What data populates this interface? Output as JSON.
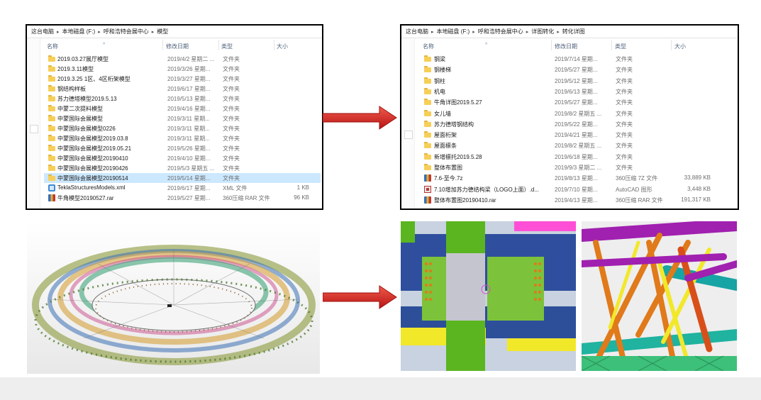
{
  "colors": {
    "arrow": "#d61f1f",
    "selection": "#cce8ff",
    "folder": "#f7cf58"
  },
  "left_explorer": {
    "breadcrumb": [
      "这台电脑",
      "本地磁盘 (F:)",
      "呼和浩特会展中心",
      "模型"
    ],
    "columns": {
      "name": "名称",
      "date": "修改日期",
      "type": "类型",
      "size": "大小"
    },
    "files": [
      {
        "name": "2019.03.27展厅模型",
        "date": "2019/4/2 星期二 ...",
        "type": "文件夹",
        "size": "",
        "icon": "folder-icon"
      },
      {
        "name": "2019.3.11模型",
        "date": "2019/3/26 星期...",
        "type": "文件夹",
        "size": "",
        "icon": "folder-icon"
      },
      {
        "name": "2019.3.25 1区、4区桁架模型",
        "date": "2019/3/27 星期...",
        "type": "文件夹",
        "size": "",
        "icon": "folder-icon"
      },
      {
        "name": "钢结构样板",
        "date": "2019/6/17 星期...",
        "type": "文件夹",
        "size": "",
        "icon": "folder-icon"
      },
      {
        "name": "苏力德塔模型2019.5.13",
        "date": "2019/5/13 星期...",
        "type": "文件夹",
        "size": "",
        "icon": "folder-icon"
      },
      {
        "name": "中蒙二次提料模型",
        "date": "2019/4/16 星期...",
        "type": "文件夹",
        "size": "",
        "icon": "folder-icon"
      },
      {
        "name": "中蒙国际会展模型",
        "date": "2019/3/11 星期...",
        "type": "文件夹",
        "size": "",
        "icon": "folder-icon"
      },
      {
        "name": "中蒙国际会展模型0226",
        "date": "2019/3/11 星期...",
        "type": "文件夹",
        "size": "",
        "icon": "folder-icon"
      },
      {
        "name": "中蒙国际会展模型2019.03.8",
        "date": "2019/3/11 星期...",
        "type": "文件夹",
        "size": "",
        "icon": "folder-icon"
      },
      {
        "name": "中蒙国际会展模型2019.05.21",
        "date": "2019/5/26 星期...",
        "type": "文件夹",
        "size": "",
        "icon": "folder-icon"
      },
      {
        "name": "中蒙国际会展模型20190410",
        "date": "2019/4/10 星期...",
        "type": "文件夹",
        "size": "",
        "icon": "folder-icon"
      },
      {
        "name": "中蒙国际会展模型20190426",
        "date": "2019/5/3 星期五 ...",
        "type": "文件夹",
        "size": "",
        "icon": "folder-icon"
      },
      {
        "name": "中蒙国际会展模型20190514",
        "date": "2019/5/14 星期...",
        "type": "文件夹",
        "size": "",
        "icon": "folder-icon",
        "selected": true
      },
      {
        "name": "TeklaStructuresModels.xml",
        "date": "2019/6/17 星期...",
        "type": "XML 文件",
        "size": "1 KB",
        "icon": "xml-file-icon"
      },
      {
        "name": "牛角模型20190527.rar",
        "date": "2019/5/27 星期...",
        "type": "360压缩 RAR 文件",
        "size": "96 KB",
        "icon": "rar-file-icon"
      }
    ]
  },
  "right_explorer": {
    "breadcrumb": [
      "这台电脑",
      "本地磁盘 (F:)",
      "呼和浩特会展中心",
      "详图转化",
      "转化详图"
    ],
    "columns": {
      "name": "名称",
      "date": "修改日期",
      "type": "类型",
      "size": "大小"
    },
    "files": [
      {
        "name": "钢梁",
        "date": "2019/7/14 星期...",
        "type": "文件夹",
        "size": "",
        "icon": "folder-icon"
      },
      {
        "name": "钢楼梯",
        "date": "2019/5/27 星期...",
        "type": "文件夹",
        "size": "",
        "icon": "folder-icon"
      },
      {
        "name": "钢柱",
        "date": "2019/5/12 星期...",
        "type": "文件夹",
        "size": "",
        "icon": "folder-icon"
      },
      {
        "name": "机电",
        "date": "2019/6/13 星期...",
        "type": "文件夹",
        "size": "",
        "icon": "folder-icon"
      },
      {
        "name": "牛角详图2019.5.27",
        "date": "2019/5/27 星期...",
        "type": "文件夹",
        "size": "",
        "icon": "folder-icon"
      },
      {
        "name": "女儿墙",
        "date": "2019/8/2 星期五 ...",
        "type": "文件夹",
        "size": "",
        "icon": "folder-icon"
      },
      {
        "name": "苏力德塔钢结构",
        "date": "2019/5/22 星期...",
        "type": "文件夹",
        "size": "",
        "icon": "folder-icon"
      },
      {
        "name": "屋面桁架",
        "date": "2019/4/21 星期...",
        "type": "文件夹",
        "size": "",
        "icon": "folder-icon"
      },
      {
        "name": "屋面檩条",
        "date": "2019/8/2 星期五 ...",
        "type": "文件夹",
        "size": "",
        "icon": "folder-icon"
      },
      {
        "name": "新增檩托2019.5.28",
        "date": "2019/6/18 星期...",
        "type": "文件夹",
        "size": "",
        "icon": "folder-icon"
      },
      {
        "name": "整体布置图",
        "date": "2019/9/3 星期二 ...",
        "type": "文件夹",
        "size": "",
        "icon": "folder-icon"
      },
      {
        "name": "7.6-至今.7z",
        "date": "2019/8/13 星期...",
        "type": "360压缩 7Z 文件",
        "size": "33,889 KB",
        "icon": "archive-7z-icon"
      },
      {
        "name": "7.10增加苏力德结构梁（LOGO上面）.d...",
        "date": "2019/7/10 星期...",
        "type": "AutoCAD 图形",
        "size": "3,448 KB",
        "icon": "dwg-file-icon"
      },
      {
        "name": "整体布置图20190410.rar",
        "date": "2019/4/13 星期...",
        "type": "360压缩 RAR 文件",
        "size": "191,317 KB",
        "icon": "rar-file-icon"
      }
    ]
  },
  "images": {
    "ring_model": "3D steel ring model render",
    "joint_detail": "Steel column joint detail render",
    "truss_detail": "Steel pipe truss detail render"
  }
}
